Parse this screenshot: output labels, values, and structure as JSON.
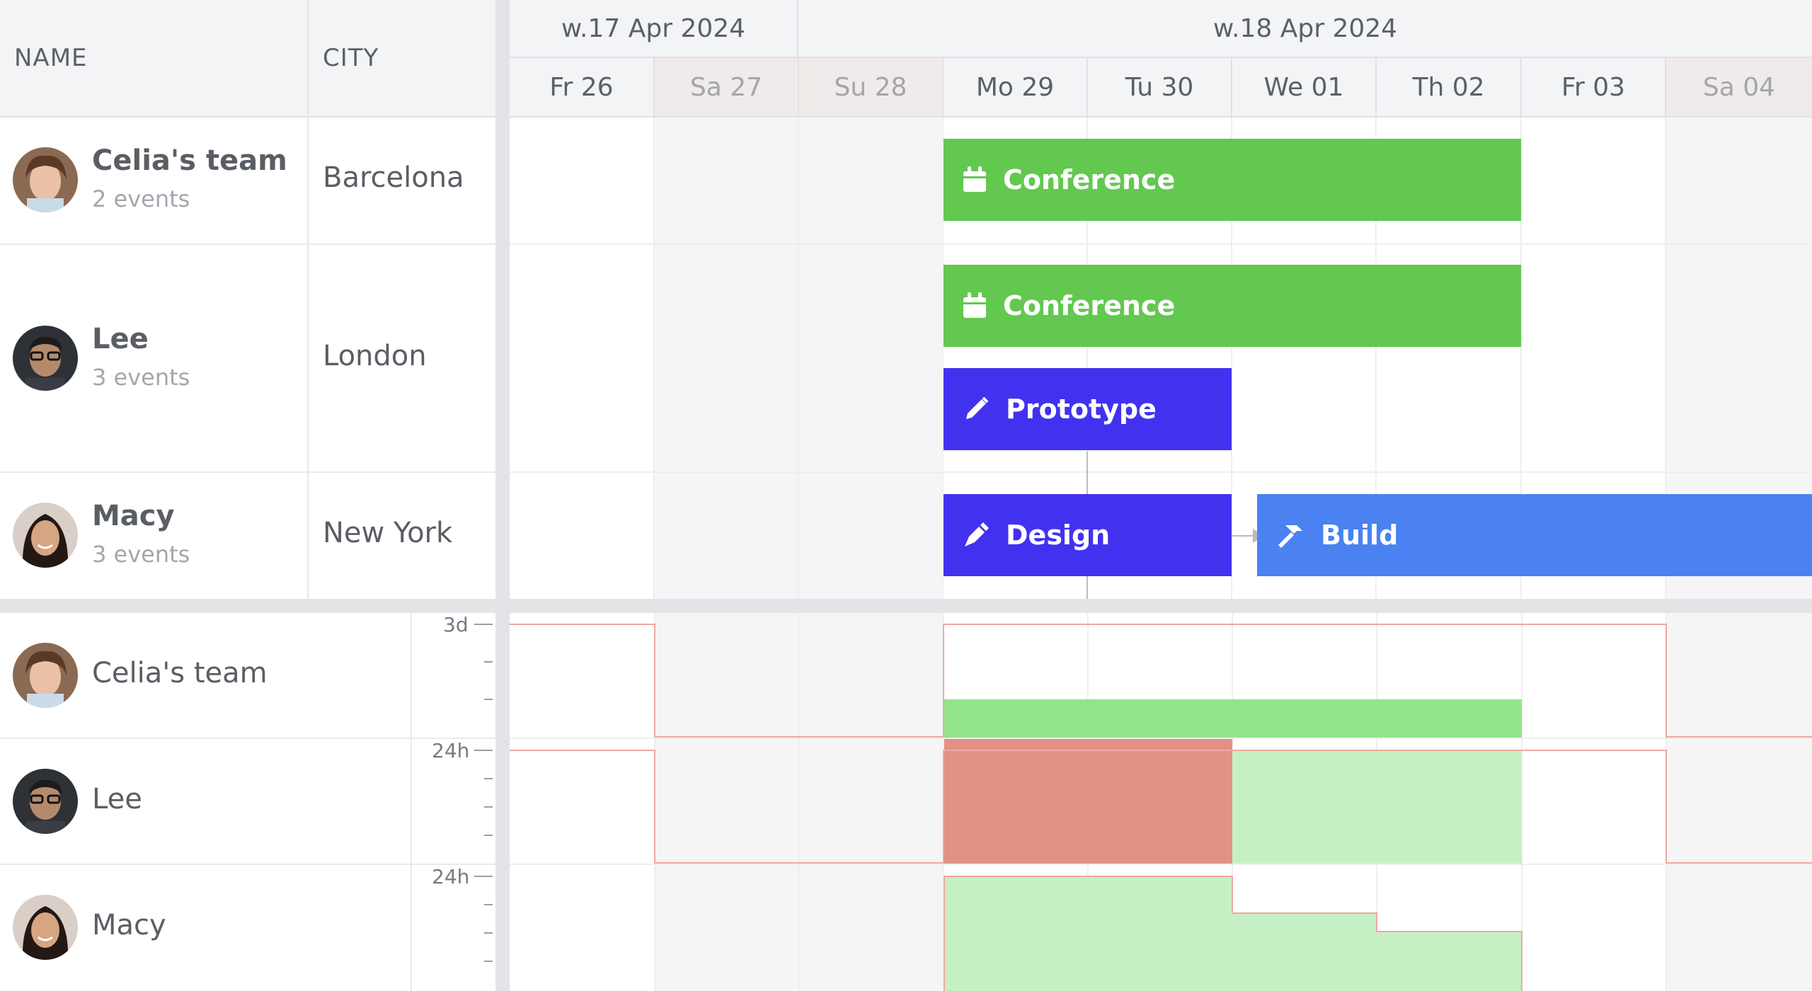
{
  "columns": {
    "name": "NAME",
    "city": "CITY"
  },
  "weeks": [
    {
      "label": "w.17 Apr 2024"
    },
    {
      "label": "w.18 Apr 2024"
    }
  ],
  "days": [
    {
      "label": "Fr 26",
      "weekend": false
    },
    {
      "label": "Sa 27",
      "weekend": true
    },
    {
      "label": "Su 28",
      "weekend": true
    },
    {
      "label": "Mo 29",
      "weekend": false
    },
    {
      "label": "Tu 30",
      "weekend": false
    },
    {
      "label": "We 01",
      "weekend": false
    },
    {
      "label": "Th 02",
      "weekend": false
    },
    {
      "label": "Fr 03",
      "weekend": false
    },
    {
      "label": "Sa 04",
      "weekend": true
    }
  ],
  "resources": [
    {
      "name": "Celia's team",
      "events_label": "2 events",
      "city": "Barcelona"
    },
    {
      "name": "Lee",
      "events_label": "3 events",
      "city": "London"
    },
    {
      "name": "Macy",
      "events_label": "3 events",
      "city": "New York"
    }
  ],
  "events": [
    {
      "name": "Conference",
      "icon": "calendar-icon",
      "color": "#63c84f",
      "resource": 0
    },
    {
      "name": "Conference",
      "icon": "calendar-icon",
      "color": "#63c84f",
      "resource": 1
    },
    {
      "name": "Prototype",
      "icon": "pencil-icon",
      "color": "#4232f0",
      "resource": 1
    },
    {
      "name": "Design",
      "icon": "pen-nib-icon",
      "color": "#4232f0",
      "resource": 2
    },
    {
      "name": "Build",
      "icon": "hammer-icon",
      "color": "#4a82f1",
      "resource": 2
    }
  ],
  "histogram": {
    "rows": [
      {
        "name": "Celia's team",
        "scale_label": "3d"
      },
      {
        "name": "Lee",
        "scale_label": "24h"
      },
      {
        "name": "Macy",
        "scale_label": "24h"
      }
    ],
    "colors": {
      "ok": "#c6f0c4",
      "ok_strong": "#93e48a",
      "overallocated": "#e29185",
      "capacity_line": "#f0a8a0"
    }
  }
}
